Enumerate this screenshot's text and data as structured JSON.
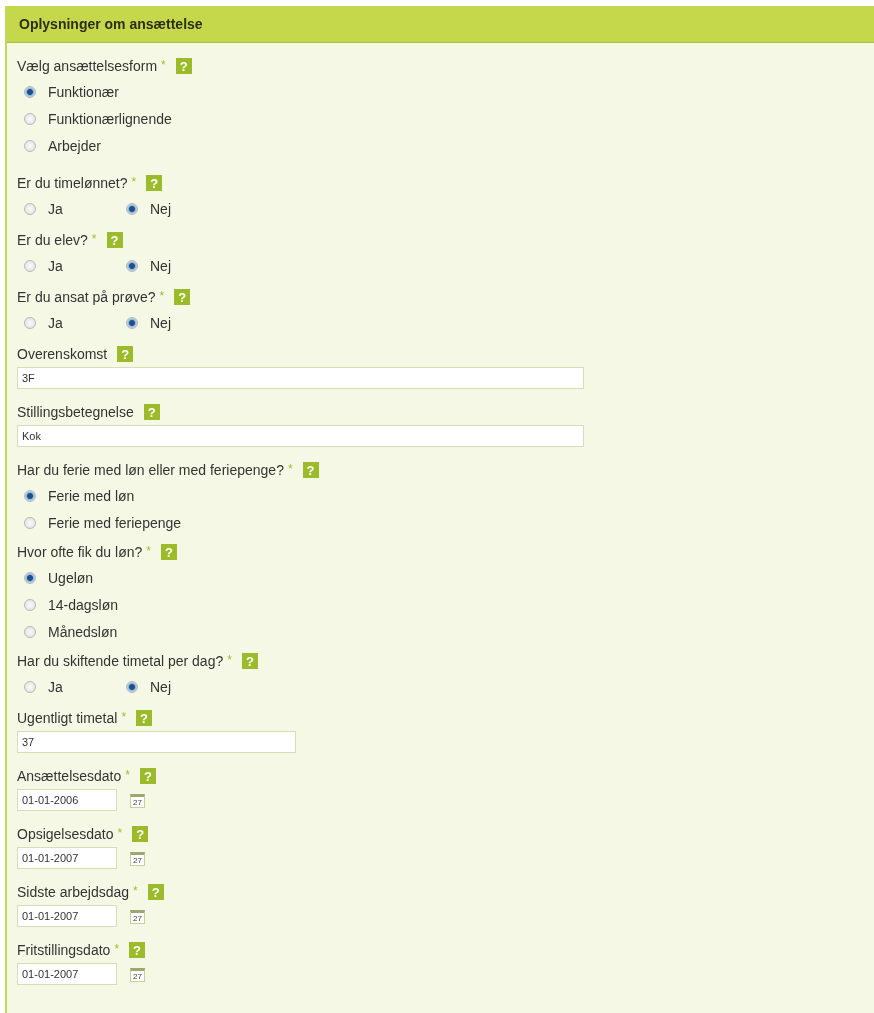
{
  "panel": {
    "title": "Oplysninger om ansættelse"
  },
  "fields": [
    {
      "kind": "radio_vertical",
      "label": "Vælg ansættelsesform",
      "required": "*",
      "help": "?",
      "options": [
        {
          "label": "Funktionær",
          "selected": true
        },
        {
          "label": "Funktionærlignende",
          "selected": false
        },
        {
          "label": "Arbejder",
          "selected": false
        }
      ]
    },
    {
      "kind": "radio_inline",
      "label": "Er du timelønnet?",
      "required": "*",
      "help": "?",
      "options": [
        {
          "label": "Ja",
          "selected": false
        },
        {
          "label": "Nej",
          "selected": true
        }
      ]
    },
    {
      "kind": "radio_inline",
      "label": "Er du elev?",
      "required": "*",
      "help": "?",
      "options": [
        {
          "label": "Ja",
          "selected": false
        },
        {
          "label": "Nej",
          "selected": true
        }
      ]
    },
    {
      "kind": "radio_inline",
      "label": "Er du ansat på prøve?",
      "required": "*",
      "help": "?",
      "options": [
        {
          "label": "Ja",
          "selected": false
        },
        {
          "label": "Nej",
          "selected": true
        }
      ]
    },
    {
      "kind": "text_wide",
      "label": "Overenskomst",
      "help": "?",
      "value": "3F"
    },
    {
      "kind": "text_wide",
      "label": "Stillingsbetegnelse",
      "help": "?",
      "value": "Kok"
    },
    {
      "kind": "radio_vertical",
      "label": "Har du ferie med løn eller med feriepenge?",
      "required": "*",
      "help": "?",
      "options": [
        {
          "label": "Ferie med løn",
          "selected": true
        },
        {
          "label": "Ferie med feriepenge",
          "selected": false
        }
      ]
    },
    {
      "kind": "radio_vertical",
      "label": "Hvor ofte fik du løn?",
      "required": "*",
      "help": "?",
      "options": [
        {
          "label": "Ugeløn",
          "selected": true
        },
        {
          "label": "14-dagsløn",
          "selected": false
        },
        {
          "label": "Månedsløn",
          "selected": false
        }
      ]
    },
    {
      "kind": "radio_inline",
      "label": "Har du skiftende timetal per dag?",
      "required": "*",
      "help": "?",
      "options": [
        {
          "label": "Ja",
          "selected": false
        },
        {
          "label": "Nej",
          "selected": true
        }
      ]
    },
    {
      "kind": "text_medium",
      "label": "Ugentligt timetal",
      "required": "*",
      "help": "?",
      "value": "37"
    },
    {
      "kind": "date",
      "label": "Ansættelsesdato",
      "required": "*",
      "help": "?",
      "value": "01-01-2006",
      "calendar_day": "27"
    },
    {
      "kind": "date",
      "label": "Opsigelsesdato",
      "required": "*",
      "help": "?",
      "value": "01-01-2007",
      "calendar_day": "27"
    },
    {
      "kind": "date",
      "label": "Sidste arbejdsdag",
      "required": "*",
      "help": "?",
      "value": "01-01-2007",
      "calendar_day": "27"
    },
    {
      "kind": "date",
      "label": "Fritstillingsdato",
      "required": "*",
      "help": "?",
      "value": "01-01-2007",
      "calendar_day": "27"
    }
  ]
}
